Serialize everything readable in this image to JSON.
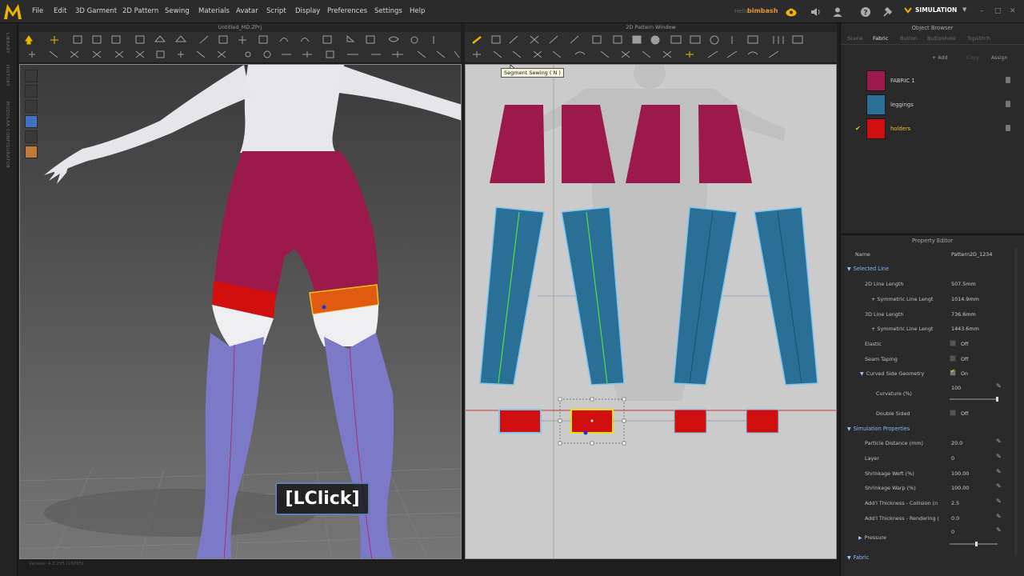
{
  "menubar": {
    "items": [
      "File",
      "Edit",
      "3D Garment",
      "2D Pattern",
      "Sewing",
      "Materials",
      "Avatar",
      "Script",
      "Display",
      "Preferences",
      "Settings",
      "Help"
    ],
    "hello": "Hello",
    "username": "bimbash",
    "mode": "SIMULATION",
    "window_buttons": [
      "–",
      "□",
      "✕"
    ]
  },
  "left_strip": {
    "labels": [
      "LIBRARY",
      "HISTORY",
      "MODULAR CONFIGURATOR"
    ]
  },
  "window3d": {
    "title": "Untitled_MD.ZPrj",
    "overlay_label": "[LClick]",
    "version": "Version: 4.2.295 (18095)"
  },
  "window2d": {
    "title": "2D Pattern Window",
    "tooltip": "Segment Sewing ( N )"
  },
  "object_browser": {
    "title": "Object Browser",
    "tabs": [
      "Scene",
      "Fabric",
      "Button",
      "Buttonhole",
      "Topstitch"
    ],
    "active_tab": "Fabric",
    "actions": {
      "add": "+ Add",
      "copy": "Copy",
      "assign": "Assign"
    },
    "fabrics": [
      {
        "name": "FABRIC 1",
        "color": "#9b1a4b",
        "selected": false
      },
      {
        "name": "leggings",
        "color": "#2a6f96",
        "selected": false
      },
      {
        "name": "holders",
        "color": "#d10f0f",
        "selected": true
      }
    ]
  },
  "property_editor": {
    "title": "Property Editor",
    "name_label": "Name",
    "name_value": "Pattern2D_1234",
    "selected_line": {
      "header": "Selected Line",
      "line_length_2d_label": "2D Line Length",
      "line_length_2d": "507.5mm",
      "sym_2d_label": "+ Symmetric Line Lengt",
      "sym_2d": "1014.9mm",
      "line_length_3d_label": "3D Line Length",
      "line_length_3d": "736.6mm",
      "sym_3d_label": "+ Symmetric Line Lengt",
      "sym_3d": "1443.6mm",
      "elastic_label": "Elastic",
      "elastic": "Off",
      "seam_taping_label": "Seam Taping",
      "seam_taping": "Off",
      "curved_label": "Curved Side Geometry",
      "curved": "On",
      "curvature_label": "Curvature (%)",
      "curvature": "100",
      "double_sided_label": "Double Sided",
      "double_sided": "Off"
    },
    "simulation": {
      "header": "Simulation Properties",
      "particle_label": "Particle Distance (mm)",
      "particle": "20.0",
      "layer_label": "Layer",
      "layer": "0",
      "weft_label": "Shrinkage Weft (%)",
      "weft": "100.00",
      "warp_label": "Shrinkage Warp (%)",
      "warp": "100.00",
      "thick_col_label": "Add'l Thickness - Collision (n",
      "thick_col": "2.5",
      "thick_ren_label": "Add'l Thickness - Rendering (",
      "thick_ren": "0.0",
      "pressure_label": "Pressure",
      "pressure": "0"
    },
    "fabric_header": "Fabric"
  },
  "colors": {
    "shorts": "#9b1a4b",
    "leggings": "#2a6f96",
    "holders": "#d10f0f",
    "avatar_legs": "#7b79c8",
    "accent": "#f0c020"
  }
}
